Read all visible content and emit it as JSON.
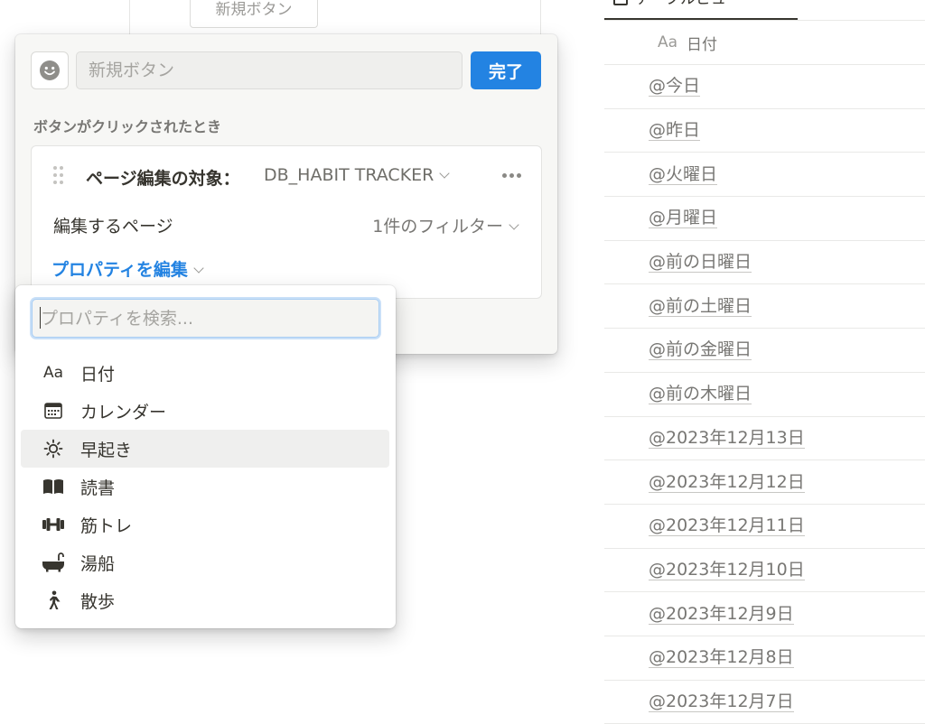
{
  "background": {
    "button_label": "新規ボタン"
  },
  "right_table": {
    "tab_label": "テーブルビュー",
    "column_icon": "Aa",
    "column_header": "日付",
    "rows": [
      "@今日",
      "@昨日",
      "@火曜日",
      "@月曜日",
      "@前の日曜日",
      "@前の土曜日",
      "@前の金曜日",
      "@前の木曜日",
      "@2023年12月13日",
      "@2023年12月12日",
      "@2023年12月11日",
      "@2023年12月10日",
      "@2023年12月9日",
      "@2023年12月8日",
      "@2023年12月7日"
    ]
  },
  "popup": {
    "emoji_icon": "smiley-icon",
    "name_placeholder": "新規ボタン",
    "done_label": "完了",
    "section_label": "ボタンがクリックされたとき",
    "action": {
      "title": "ページ編集の対象：",
      "target": "DB_HABIT TRACKER",
      "pages_label": "編集するページ",
      "filter_value": "1件のフィルター",
      "edit_property": "プロパティを編集"
    }
  },
  "dropdown": {
    "search_placeholder": "プロパティを検索...",
    "options": [
      {
        "icon": "text-aa-icon",
        "icon_text": "Aa",
        "label": "日付"
      },
      {
        "icon": "calendar-icon",
        "label": "カレンダー"
      },
      {
        "icon": "sun-icon",
        "label": "早起き",
        "highlighted": true
      },
      {
        "icon": "book-icon",
        "label": "読書"
      },
      {
        "icon": "dumbbell-icon",
        "label": "筋トレ"
      },
      {
        "icon": "bathtub-icon",
        "label": "湯船"
      },
      {
        "icon": "walking-icon",
        "label": "散歩"
      }
    ]
  },
  "colors": {
    "accent": "#2383e2",
    "text": "#37352f",
    "muted": "#787774"
  }
}
